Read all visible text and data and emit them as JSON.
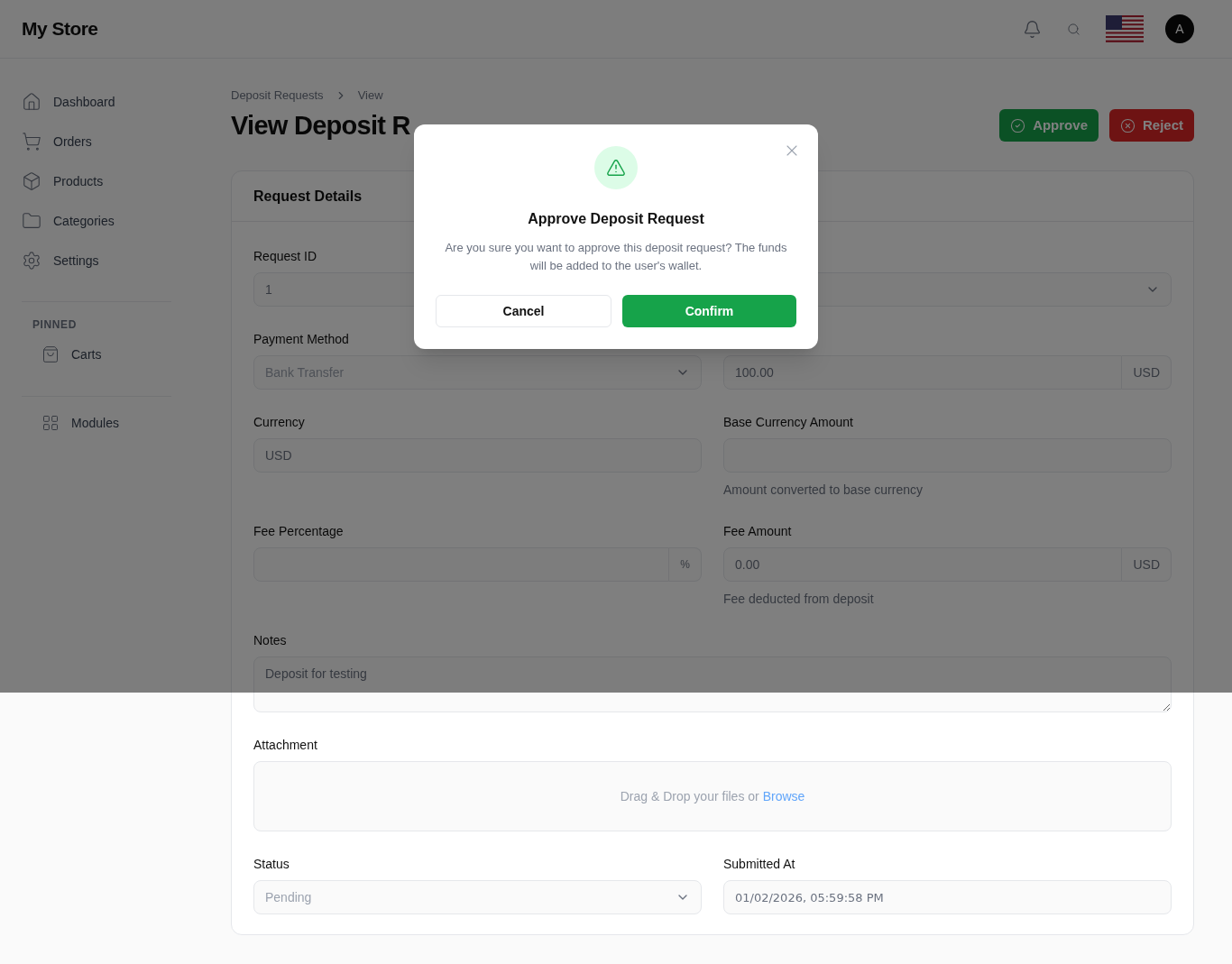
{
  "header": {
    "brand": "My Store",
    "avatar": "A"
  },
  "sidebar": {
    "items": [
      {
        "label": "Dashboard"
      },
      {
        "label": "Orders"
      },
      {
        "label": "Products"
      },
      {
        "label": "Categories"
      },
      {
        "label": "Settings"
      }
    ],
    "pinned_heading": "PINNED",
    "pinned": [
      {
        "label": "Carts"
      }
    ],
    "extra": [
      {
        "label": "Modules"
      }
    ]
  },
  "breadcrumb": [
    "Deposit Requests",
    "View"
  ],
  "title": "View Deposit R",
  "actions": [
    {
      "label": "Approve",
      "kind": "approve"
    },
    {
      "label": "Reject",
      "kind": "reject"
    }
  ],
  "card": {
    "title": "Request Details",
    "fields": [
      {
        "kind": "input",
        "label": "Request ID",
        "value": "1"
      },
      {
        "kind": "select"
      },
      {
        "kind": "select",
        "label": "Payment Method",
        "value": "Bank Transfer"
      },
      {
        "kind": "addon",
        "value": "100.00",
        "addon": "USD"
      },
      {
        "kind": "input",
        "label": "Currency",
        "value": "USD"
      },
      {
        "kind": "input",
        "label": "Base Currency Amount",
        "help": "Amount converted to base currency"
      },
      {
        "kind": "addon",
        "label": "Fee Percentage",
        "addon": "%"
      },
      {
        "kind": "addon",
        "label": "Fee Amount",
        "value": "0.00",
        "addon": "USD",
        "help": "Fee deducted from deposit"
      },
      {
        "kind": "textarea",
        "label": "Notes",
        "value": "Deposit for testing"
      },
      {
        "kind": "dropzone",
        "label": "Attachment",
        "text": "Drag & Drop your files or",
        "link": "Browse"
      },
      {
        "kind": "select",
        "label": "Status",
        "value": "Pending"
      },
      {
        "kind": "datetime",
        "label": "Submitted At",
        "value": "01/02/2026, 05:59:58 PM"
      }
    ]
  },
  "modal": {
    "title": "Approve Deposit Request",
    "message": "Are you sure you want to approve this deposit request? The funds will be added to the user's wallet.",
    "buttons": [
      {
        "label": "Cancel",
        "kind": "secondary"
      },
      {
        "label": "Confirm",
        "kind": "primary"
      }
    ]
  }
}
